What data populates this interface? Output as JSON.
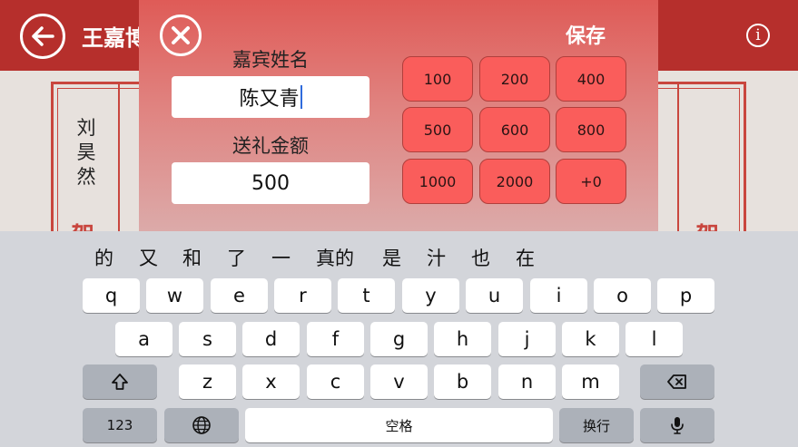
{
  "app": {
    "title": "王嘉博",
    "info_glyph": "i"
  },
  "ledger": {
    "guest_name_chars": [
      "刘",
      "昊",
      "然"
    ],
    "bottom_left_char": "贺",
    "bottom_right_char": "贺"
  },
  "modal": {
    "save_label": "保存",
    "name_label": "嘉宾姓名",
    "name_value": "陈又青",
    "amount_label": "送礼金额",
    "amount_value": "500",
    "amount_buttons": [
      "100",
      "200",
      "400",
      "500",
      "600",
      "800",
      "1000",
      "2000",
      "+0"
    ]
  },
  "keyboard": {
    "candidates": [
      "的",
      "又",
      "和",
      "了",
      "一",
      "真的",
      "是",
      "汁",
      "也",
      "在"
    ],
    "row1": [
      "q",
      "w",
      "e",
      "r",
      "t",
      "y",
      "u",
      "i",
      "o",
      "p"
    ],
    "row2": [
      "a",
      "s",
      "d",
      "f",
      "g",
      "h",
      "j",
      "k",
      "l"
    ],
    "row3": [
      "z",
      "x",
      "c",
      "v",
      "b",
      "n",
      "m"
    ],
    "numbers_label": "123",
    "space_label": "空格",
    "return_label": "换行"
  },
  "colors": {
    "header": "#b62f2c",
    "amount_button": "#fa5d5b",
    "ledger_line": "#c9463e"
  }
}
